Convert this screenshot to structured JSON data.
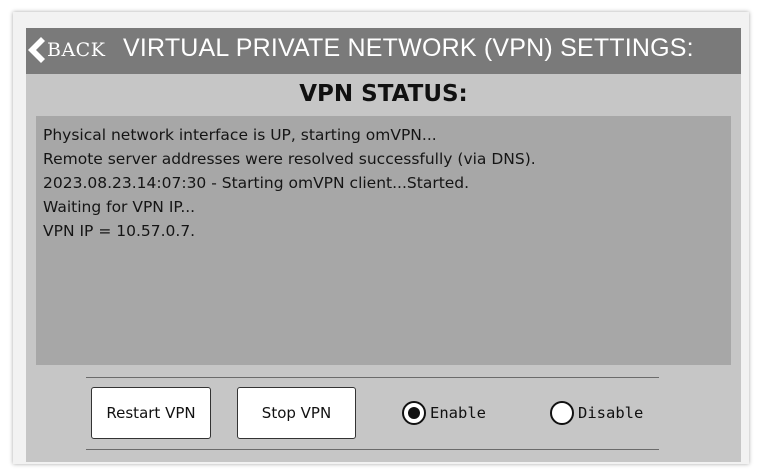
{
  "header": {
    "back_label": "BACK",
    "title": "VIRTUAL PRIVATE NETWORK (VPN) SETTINGS:"
  },
  "status": {
    "heading": "VPN STATUS:",
    "log_lines": [
      "Physical network interface is UP, starting omVPN...",
      "Remote server addresses were resolved successfully (via DNS).",
      "2023.08.23.14:07:30 - Starting omVPN client...Started.",
      "Waiting for VPN IP...",
      "VPN IP = 10.57.0.7."
    ]
  },
  "controls": {
    "restart_label": "Restart VPN",
    "stop_label": "Stop VPN",
    "enable_label": "Enable",
    "disable_label": "Disable",
    "selected": "Enable"
  },
  "colors": {
    "header_bg": "#7a7a7a",
    "panel_bg": "#c6c6c6",
    "log_bg": "#a7a7a7"
  },
  "icons": {
    "back": "chevron-left-icon"
  }
}
